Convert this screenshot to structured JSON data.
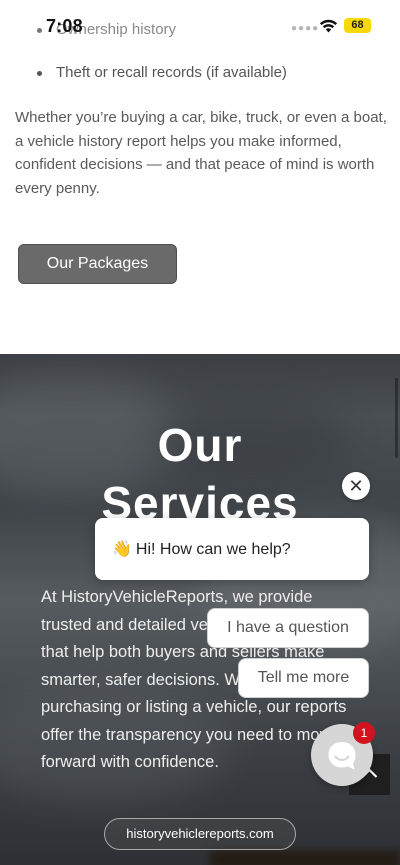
{
  "status_bar": {
    "time": "7:08",
    "battery": "68",
    "icons": [
      "signal-dots-icon",
      "wifi-icon",
      "battery-icon"
    ]
  },
  "content": {
    "faded_item": "Ownership history",
    "list_item": "Theft or recall records (if available)",
    "intro_paragraph": "Whether you’re buying a car, bike, truck, or even a boat, a vehicle history report helps you make informed, confident decisions — and that peace of mind is worth every penny.",
    "packages_button": "Our Packages"
  },
  "services": {
    "title_line1": "Our",
    "title_line2": "Services",
    "paragraph": "At HistoryVehicleReports, we provide trusted and detailed vehicle history reports that help both buyers and sellers make smarter, safer decisions. Whether you’re purchasing or listing a vehicle, our reports offer the transparency you need to move forward with confidence.",
    "domain_button": "historyvehiclereports.com"
  },
  "chat": {
    "greeting_emoji": "👋",
    "greeting": "Hi! How can we help?",
    "replies": [
      "I have a question",
      "Tell me more"
    ],
    "badge_count": "1",
    "close_symbol": "✕"
  },
  "colors": {
    "accent_button": "#6a6a6a",
    "badge": "#d0131f",
    "battery": "#f5d90a"
  }
}
